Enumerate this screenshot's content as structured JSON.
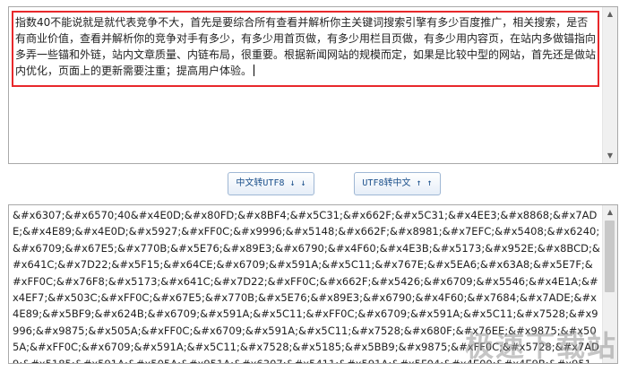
{
  "input": {
    "text": "指数40不能说就是就代表竞争不大，首先是要综合所有查看并解析你主关键词搜索引擎有多少百度推广，相关搜索，是否有商业价值，查看并解析你的竞争对手有多少，有多少用首页做，有多少用栏目页做，有多少用内容页，在站内多做锚指向多弄一些锚和外链，站内文章质量、内链布局，很重要。根据新闻网站的规模而定，如果是比较中型的网站，首先还是做站内优化，页面上的更新需要注重；提高用户体验。"
  },
  "buttons": {
    "to_utf8": "中文转UTF8 ↓ ↓",
    "to_chinese": "UTF8转中文 ↑ ↑"
  },
  "output": {
    "text": "&#x6307;&#x6570;40&#x4E0D;&#x80FD;&#x8BF4;&#x5C31;&#x662F;&#x5C31;&#x4EE3;&#x8868;&#x7ADE;&#x4E89;&#x4E0D;&#x5927;&#xFF0C;&#x9996;&#x5148;&#x662F;&#x8981;&#x7EFC;&#x5408;&#x6240;&#x6709;&#x67E5;&#x770B;&#x5E76;&#x89E3;&#x6790;&#x4F60;&#x4E3B;&#x5173;&#x952E;&#x8BCD;&#x641C;&#x7D22;&#x5F15;&#x64CE;&#x6709;&#x591A;&#x5C11;&#x767E;&#x5EA6;&#x63A8;&#x5E7F;&#xFF0C;&#x76F8;&#x5173;&#x641C;&#x7D22;&#xFF0C;&#x662F;&#x5426;&#x6709;&#x5546;&#x4E1A;&#x4EF7;&#x503C;&#xFF0C;&#x67E5;&#x770B;&#x5E76;&#x89E3;&#x6790;&#x4F60;&#x7684;&#x7ADE;&#x4E89;&#x5BF9;&#x624B;&#x6709;&#x591A;&#x5C11;&#xFF0C;&#x6709;&#x591A;&#x5C11;&#x7528;&#x9996;&#x9875;&#x505A;&#xFF0C;&#x6709;&#x591A;&#x5C11;&#x7528;&#x680F;&#x76EE;&#x9875;&#x505A;&#xFF0C;&#x6709;&#x591A;&#x5C11;&#x7528;&#x5185;&#x5BB9;&#x9875;&#xFF0C;&#x5728;&#x7AD9;&#x5185;&#x591A;&#x505A;&#x951A;&#x6307;&#x5411;&#x591A;&#x5F04;&#x4E00;&#x4E9B;&#x951A;&#x548C;&#x5916;&#x94FE;&#xFF0C;&#x7AD9;&#x5185;"
  },
  "watermark": "极速下载站"
}
